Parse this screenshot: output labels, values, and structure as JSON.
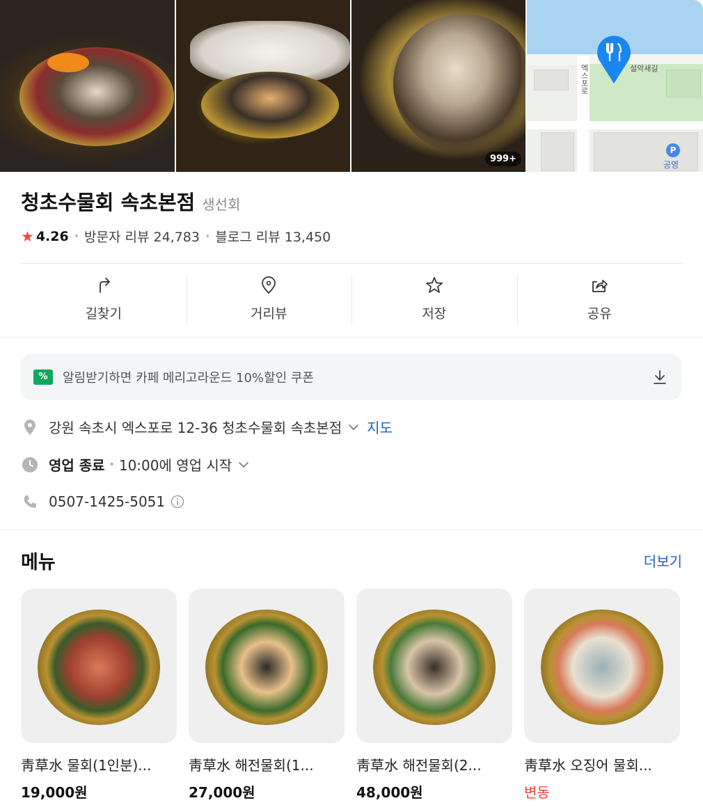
{
  "gallery": {
    "photo_count_badge": "999+",
    "map": {
      "road_label_vertical": "엑스포로",
      "road_label_top": "설악새길",
      "parking_symbol": "P",
      "parking_label": "공영"
    }
  },
  "place": {
    "name": "청초수물회 속초본점",
    "category": "생선회",
    "rating": "4.26",
    "visitor_review_label": "방문자 리뷰",
    "visitor_review_count": "24,783",
    "blog_review_label": "블로그 리뷰",
    "blog_review_count": "13,450"
  },
  "actions": [
    {
      "label": "길찾기",
      "icon": "directions-icon"
    },
    {
      "label": "거리뷰",
      "icon": "streetview-pin-icon"
    },
    {
      "label": "저장",
      "icon": "star-icon"
    },
    {
      "label": "공유",
      "icon": "share-icon"
    }
  ],
  "coupon": {
    "icon_text": "%",
    "text": "알림받기하면 카페 메리고라운드 10%할인 쿠폰"
  },
  "info": {
    "address": "강원 속초시 엑스포로 12-36 청초수물회 속초본점",
    "map_link": "지도",
    "hours_status": "영업 종료",
    "hours_detail": "10:00에 영업 시작",
    "phone": "0507-1425-5051"
  },
  "menu": {
    "title": "메뉴",
    "more_label": "더보기",
    "items": [
      {
        "name": "靑草水 물회(1인분)...",
        "price": "19,000원"
      },
      {
        "name": "靑草水 해전물회(1...",
        "price": "27,000원"
      },
      {
        "name": "靑草水 해전물회(2...",
        "price": "48,000원"
      },
      {
        "name": "靑草水 오징어 물회...",
        "price": "변동"
      }
    ]
  },
  "colors": {
    "accent_link": "#1a5fc2",
    "rating_star": "#f0473a",
    "coupon_green": "#12a75f",
    "price_variable": "#e8423a"
  }
}
